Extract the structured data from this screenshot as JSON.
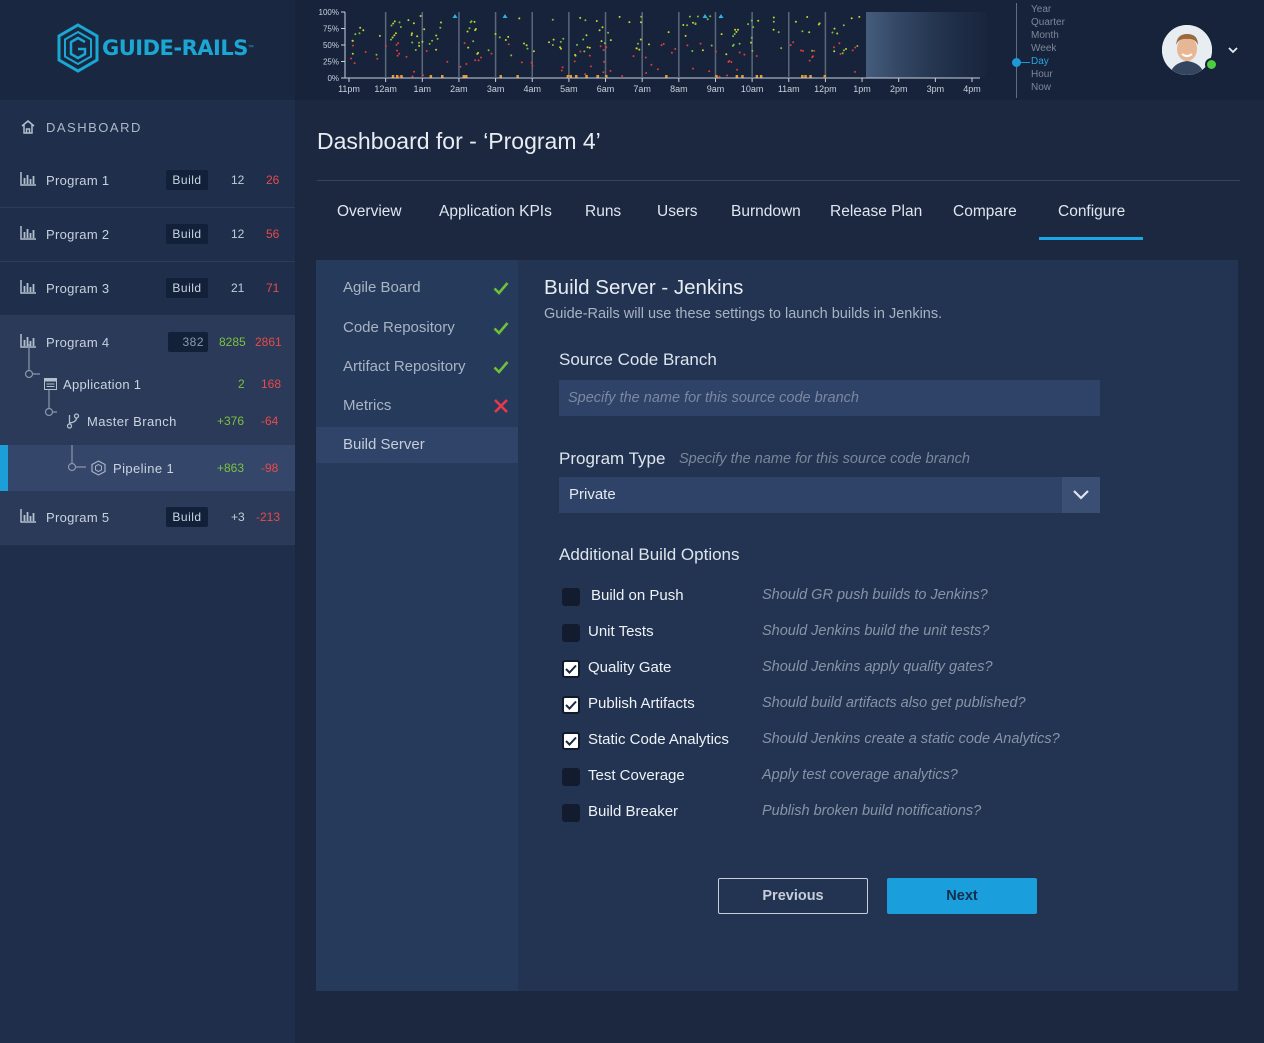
{
  "colors": {
    "accent": "#1a9fdc",
    "success": "#7cc23f",
    "danger": "#e84a4a",
    "sidebar": "#1f2e4b",
    "panel": "#233452"
  },
  "brand": {
    "name": "GUIDE-RAILS",
    "tm": "™"
  },
  "timeline": {
    "y_ticks": [
      "100%",
      "75%",
      "50%",
      "25%",
      "0%"
    ],
    "x_ticks": [
      "11pm",
      "12am",
      "1am",
      "2am",
      "3am",
      "4am",
      "5am",
      "6am",
      "7am",
      "8am",
      "9am",
      "10am",
      "11am",
      "12pm",
      "1pm",
      "2pm",
      "3pm",
      "4pm"
    ]
  },
  "range": {
    "items": [
      "Year",
      "Quarter",
      "Month",
      "Week",
      "Day",
      "Hour",
      "Now"
    ],
    "active": "Day"
  },
  "sidebar": {
    "dashboard_label": "DASHBOARD",
    "programs": [
      {
        "name": "Program 1",
        "badge": "Build",
        "a": "12",
        "b": "26"
      },
      {
        "name": "Program 2",
        "badge": "Build",
        "a": "12",
        "b": "56"
      },
      {
        "name": "Program 3",
        "badge": "Build",
        "a": "21",
        "b": "71"
      },
      {
        "name": "Program 4",
        "badge": "382",
        "a": "8285",
        "b": "2861"
      },
      {
        "name": "Program 5",
        "badge": "Build",
        "a": "+3",
        "b": "-213"
      }
    ],
    "application": {
      "name": "Application 1",
      "a": "2",
      "b": "168"
    },
    "branch": {
      "name": "Master Branch",
      "a": "+376",
      "b": "-64"
    },
    "pipeline": {
      "name": "Pipeline 1",
      "a": "+863",
      "b": "-98"
    }
  },
  "main": {
    "title": "Dashboard for - ‘Program 4’",
    "tabs": [
      "Overview",
      "Application KPIs",
      "Runs",
      "Users",
      "Burndown",
      "Release Plan",
      "Compare",
      "Configure"
    ],
    "active_tab": "Configure"
  },
  "config": {
    "nav": [
      {
        "label": "Agile Board",
        "status": "check"
      },
      {
        "label": "Code Repository",
        "status": "check"
      },
      {
        "label": "Artifact Repository",
        "status": "check"
      },
      {
        "label": "Metrics",
        "status": "cross"
      },
      {
        "label": "Build Server",
        "status": "active"
      }
    ],
    "title": "Build Server - Jenkins",
    "subtitle": "Guide-Rails will use these settings to launch builds in Jenkins.",
    "branch_label": "Source Code Branch",
    "branch_placeholder": "Specify the name for this source code branch",
    "type_label": "Program Type",
    "type_hint": "Specify the name for this source code branch",
    "type_value": "Private",
    "options_label": "Additional Build Options",
    "options": [
      {
        "label": "Build on Push",
        "hint": "Should GR push builds to Jenkins?",
        "checked": false
      },
      {
        "label": "Unit Tests",
        "hint": "Should Jenkins build the unit tests?",
        "checked": false
      },
      {
        "label": "Quality Gate",
        "hint": "Should Jenkins apply quality gates?",
        "checked": true
      },
      {
        "label": "Publish Artifacts",
        "hint": "Should build artifacts also get published?",
        "checked": true
      },
      {
        "label": "Static Code Analytics",
        "hint": "Should Jenkins create a static code Analytics?",
        "checked": true
      },
      {
        "label": "Test Coverage",
        "hint": "Apply test coverage analytics?",
        "checked": false
      },
      {
        "label": "Build Breaker",
        "hint": "Publish broken build notifications?",
        "checked": false
      }
    ],
    "previous_label": "Previous",
    "next_label": "Next"
  }
}
